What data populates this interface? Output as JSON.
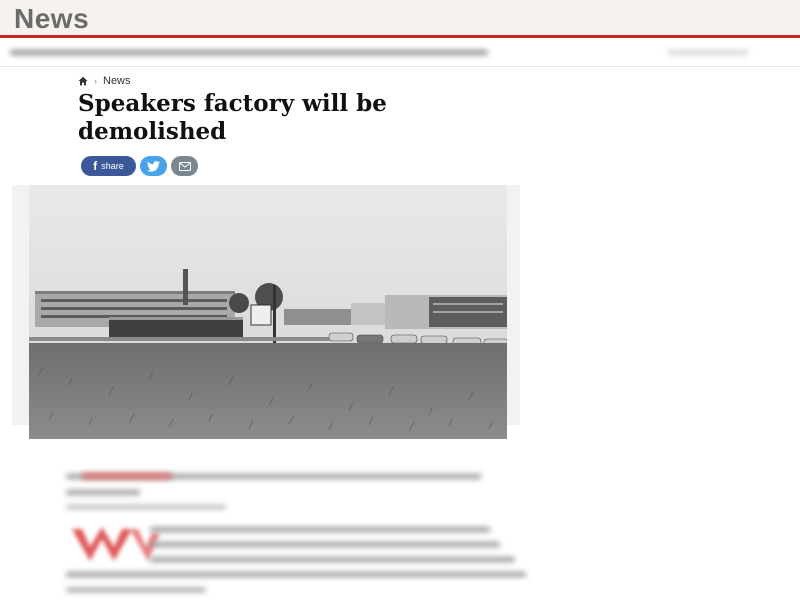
{
  "header": {
    "brand": "News"
  },
  "breadcrumb": {
    "home_icon": "home-icon",
    "section": "News"
  },
  "article": {
    "headline": "Speakers factory will be demolished"
  },
  "share": {
    "facebook_label": "share",
    "twitter_icon": "twitter-icon",
    "email_icon": "email-icon"
  },
  "colors": {
    "accent": "#c62828",
    "facebook": "#3b5998",
    "twitter": "#4aa3e8",
    "email": "#7a8791"
  }
}
